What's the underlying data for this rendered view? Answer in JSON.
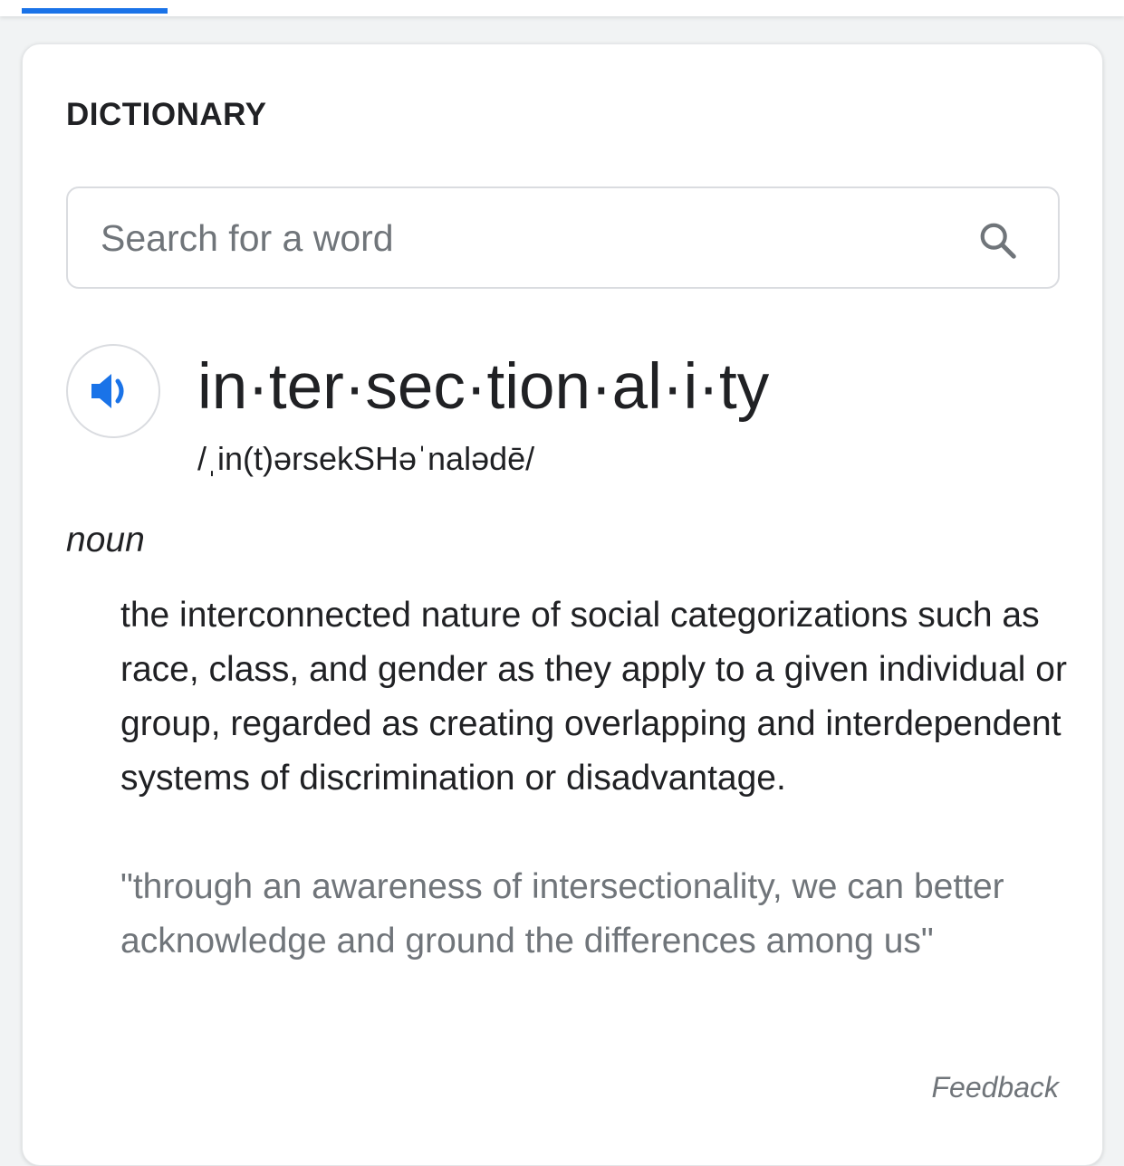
{
  "colors": {
    "accent": "#1a73e8",
    "text_primary": "#202124",
    "text_secondary": "#70757a",
    "border": "#dadce0"
  },
  "card": {
    "title": "DICTIONARY"
  },
  "search": {
    "placeholder": "Search for a word",
    "value": "",
    "icon": "search-icon"
  },
  "entry": {
    "audio_icon": "speaker-icon",
    "headword": "in·ter·sec·tion·al·i·ty",
    "phonetic": "/ˌin(t)ərsekSHəˈnalədē/",
    "part_of_speech": "noun",
    "definition": "the interconnected nature of social categorizations such as race, class, and gender as they apply to a given individual or group, regarded as creating overlapping and interdependent systems of discrimination or disadvantage.",
    "example": "\"through an awareness of intersectionality, we can better acknowledge and ground the differences among us\""
  },
  "footer": {
    "feedback_label": "Feedback"
  }
}
